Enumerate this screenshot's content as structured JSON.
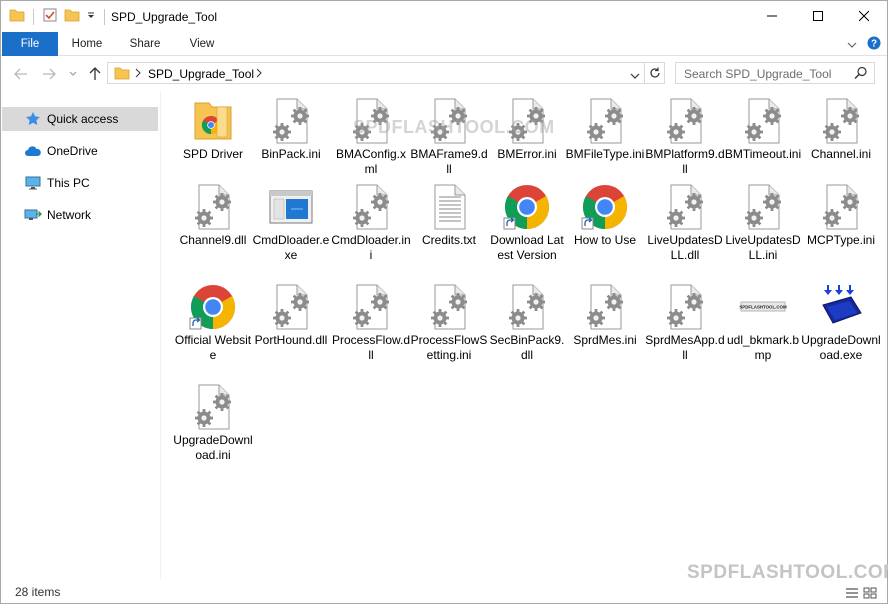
{
  "window": {
    "title": "SPD_Upgrade_Tool"
  },
  "ribbon": {
    "tabs": [
      "File",
      "Home",
      "Share",
      "View"
    ]
  },
  "address": {
    "path": "SPD_Upgrade_Tool",
    "search_placeholder": "Search SPD_Upgrade_Tool"
  },
  "sidebar": {
    "items": [
      {
        "label": "Quick access",
        "icon": "star-icon"
      },
      {
        "label": "OneDrive",
        "icon": "cloud-icon"
      },
      {
        "label": "This PC",
        "icon": "monitor-icon"
      },
      {
        "label": "Network",
        "icon": "network-icon"
      }
    ]
  },
  "files": [
    {
      "label": "SPD Driver",
      "icon": "folder-icon"
    },
    {
      "label": "BinPack.ini",
      "icon": "settings-file-icon"
    },
    {
      "label": "BMAConfig.xml",
      "icon": "settings-file-icon"
    },
    {
      "label": "BMAFrame9.dll",
      "icon": "settings-file-icon"
    },
    {
      "label": "BMError.ini",
      "icon": "settings-file-icon"
    },
    {
      "label": "BMFileType.ini",
      "icon": "settings-file-icon"
    },
    {
      "label": "BMPlatform9.dll",
      "icon": "settings-file-icon"
    },
    {
      "label": "BMTimeout.ini",
      "icon": "settings-file-icon"
    },
    {
      "label": "Channel.ini",
      "icon": "settings-file-icon"
    },
    {
      "label": "Channel9.dll",
      "icon": "settings-file-icon"
    },
    {
      "label": "CmdDloader.exe",
      "icon": "exe-window-icon"
    },
    {
      "label": "CmdDloader.ini",
      "icon": "settings-file-icon"
    },
    {
      "label": "Credits.txt",
      "icon": "text-file-icon"
    },
    {
      "label": "Download Latest Version",
      "icon": "chrome-shortcut-icon"
    },
    {
      "label": "How to Use",
      "icon": "chrome-shortcut-icon"
    },
    {
      "label": "LiveUpdatesDLL.dll",
      "icon": "settings-file-icon"
    },
    {
      "label": "LiveUpdatesDLL.ini",
      "icon": "settings-file-icon"
    },
    {
      "label": "MCPType.ini",
      "icon": "settings-file-icon"
    },
    {
      "label": "Official Website",
      "icon": "chrome-shortcut-icon"
    },
    {
      "label": "PortHound.dll",
      "icon": "settings-file-icon"
    },
    {
      "label": "ProcessFlow.dll",
      "icon": "settings-file-icon"
    },
    {
      "label": "ProcessFlowSetting.ini",
      "icon": "settings-file-icon"
    },
    {
      "label": "SecBinPack9.dll",
      "icon": "settings-file-icon"
    },
    {
      "label": "SprdMes.ini",
      "icon": "settings-file-icon"
    },
    {
      "label": "SprdMesApp.dll",
      "icon": "settings-file-icon"
    },
    {
      "label": "udl_bkmark.bmp",
      "icon": "bitmap-icon",
      "image_text": "SPDFLASHTOOL.COM"
    },
    {
      "label": "UpgradeDownload.exe",
      "icon": "upgrade-exe-icon"
    },
    {
      "label": "UpgradeDownload.ini",
      "icon": "settings-file-icon"
    }
  ],
  "status": {
    "item_count": "28 items"
  },
  "watermarks": [
    "SPDFLASHTOOL.COM",
    "SPDFLASHTOOL.COM"
  ],
  "colors": {
    "accent": "#1a6fc8",
    "selected": "#d9d9d9",
    "folder": "#f5c451"
  }
}
